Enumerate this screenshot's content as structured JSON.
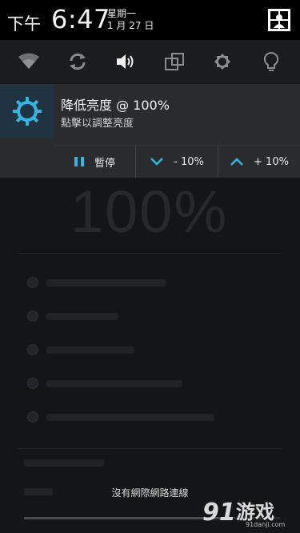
{
  "status": {
    "ampm": "下午",
    "time": "6:47",
    "weekday": "星期一",
    "date": "1 月 27 日"
  },
  "quick_settings": [
    {
      "name": "wifi-icon"
    },
    {
      "name": "sync-icon"
    },
    {
      "name": "sound-icon"
    },
    {
      "name": "rotate-icon"
    },
    {
      "name": "brightness-icon"
    },
    {
      "name": "flashlight-icon"
    }
  ],
  "notification": {
    "title": "降低亮度 @ 100%",
    "subtitle": "點擊以調整亮度",
    "actions": {
      "pause": "暫停",
      "decrease": "- 10%",
      "increase": "+ 10%"
    }
  },
  "background": {
    "big_value": "100%",
    "toast": "沒有網際網路連線"
  },
  "watermark": {
    "logo_text": "91游戏",
    "url": "91danji.com"
  },
  "colors": {
    "accent": "#33b5e5",
    "status_bar": "#000000",
    "notification_bg": "#2a2b2c"
  }
}
